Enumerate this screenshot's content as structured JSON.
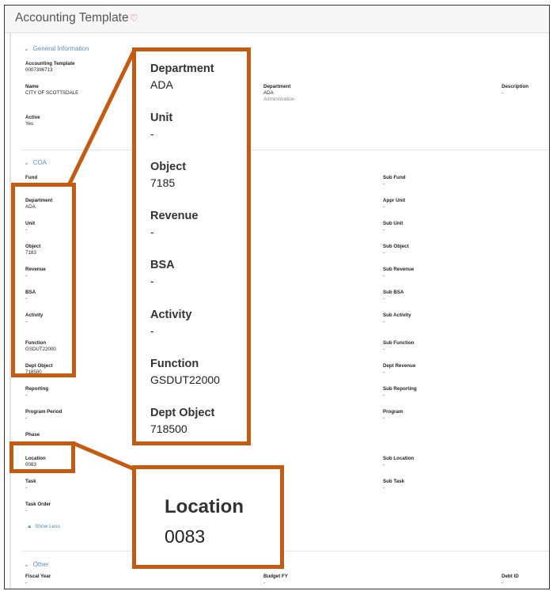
{
  "page": {
    "title": "Accounting Template",
    "favorite_icon": "heart-outline-icon"
  },
  "sections": {
    "general": {
      "label": "General Information",
      "icon": "chevron-down-icon"
    },
    "coa": {
      "label": "COA",
      "icon": "chevron-down-icon"
    },
    "other": {
      "label": "Other",
      "icon": "chevron-down-icon"
    }
  },
  "general_fields": {
    "template": {
      "label": "Accounting Template",
      "value": "0007396713"
    },
    "name": {
      "label": "Name",
      "value": "CITY OF SCOTTSDALE"
    },
    "department": {
      "label": "Department",
      "value": "ADA",
      "sub": "Administration"
    },
    "description": {
      "label": "Description",
      "value": "-"
    },
    "active": {
      "label": "Active",
      "value": "Yes"
    }
  },
  "coa_left": {
    "fund": {
      "label": "Fund",
      "value": ""
    },
    "department": {
      "label": "Department",
      "value": "ADA"
    },
    "unit": {
      "label": "Unit",
      "value": "-"
    },
    "object": {
      "label": "Object",
      "value": "7183"
    },
    "revenue": {
      "label": "Revenue",
      "value": "-"
    },
    "bsa": {
      "label": "BSA",
      "value": "-"
    },
    "activity": {
      "label": "Activity",
      "value": "-"
    },
    "function": {
      "label": "Function",
      "value": "GSDUT22000"
    },
    "dept_object": {
      "label": "Dept Object",
      "value": "718500"
    },
    "reporting": {
      "label": "Reporting",
      "value": "-"
    },
    "program_period": {
      "label": "Program Period",
      "value": "-"
    },
    "phase": {
      "label": "Phase",
      "value": ""
    },
    "location": {
      "label": "Location",
      "value": "0083"
    },
    "task": {
      "label": "Task",
      "value": "-"
    },
    "task_order": {
      "label": "Task Order",
      "value": "-"
    }
  },
  "coa_right": {
    "sub_fund": {
      "label": "Sub Fund",
      "value": "-"
    },
    "appr_unit": {
      "label": "Appr Unit",
      "value": "-"
    },
    "sub_unit": {
      "label": "Sub Unit",
      "value": "-"
    },
    "sub_object": {
      "label": "Sub Object",
      "value": "-"
    },
    "sub_revenue": {
      "label": "Sub Revenue",
      "value": "-"
    },
    "sub_bsa": {
      "label": "Sub BSA",
      "value": "-"
    },
    "sub_activity": {
      "label": "Sub Activity",
      "value": "-"
    },
    "sub_function": {
      "label": "Sub Function",
      "value": "-"
    },
    "dept_revenue": {
      "label": "Dept Revenue",
      "value": "-"
    },
    "sub_reporting": {
      "label": "Sub Reporting",
      "value": "-"
    },
    "program": {
      "label": "Program",
      "value": "-"
    },
    "sub_location": {
      "label": "Sub Location",
      "value": "-"
    },
    "sub_task": {
      "label": "Sub Task",
      "value": "-"
    }
  },
  "show_less": {
    "label": "Show Less",
    "icon": "caret-up-icon"
  },
  "other_fields": {
    "fiscal_year": {
      "label": "Fiscal Year",
      "value": "-"
    },
    "budget_fy": {
      "label": "Budget FY",
      "value": "-"
    },
    "debt_id": {
      "label": "Debt ID",
      "value": "-"
    }
  },
  "zoom_callout": {
    "department": {
      "label": "Department",
      "value": "ADA"
    },
    "unit": {
      "label": "Unit",
      "value": "-"
    },
    "object": {
      "label": "Object",
      "value": "7185"
    },
    "revenue": {
      "label": "Revenue",
      "value": "-"
    },
    "bsa": {
      "label": "BSA",
      "value": "-"
    },
    "activity": {
      "label": "Activity",
      "value": "-"
    },
    "function": {
      "label": "Function",
      "value": "GSDUT22000"
    },
    "dept_object": {
      "label": "Dept Object",
      "value": "718500"
    }
  },
  "location_callout": {
    "label": "Location",
    "value": "0083"
  },
  "colors": {
    "highlight": "#c55a11",
    "link": "#4a86c6",
    "favorite": "#d9534f"
  }
}
